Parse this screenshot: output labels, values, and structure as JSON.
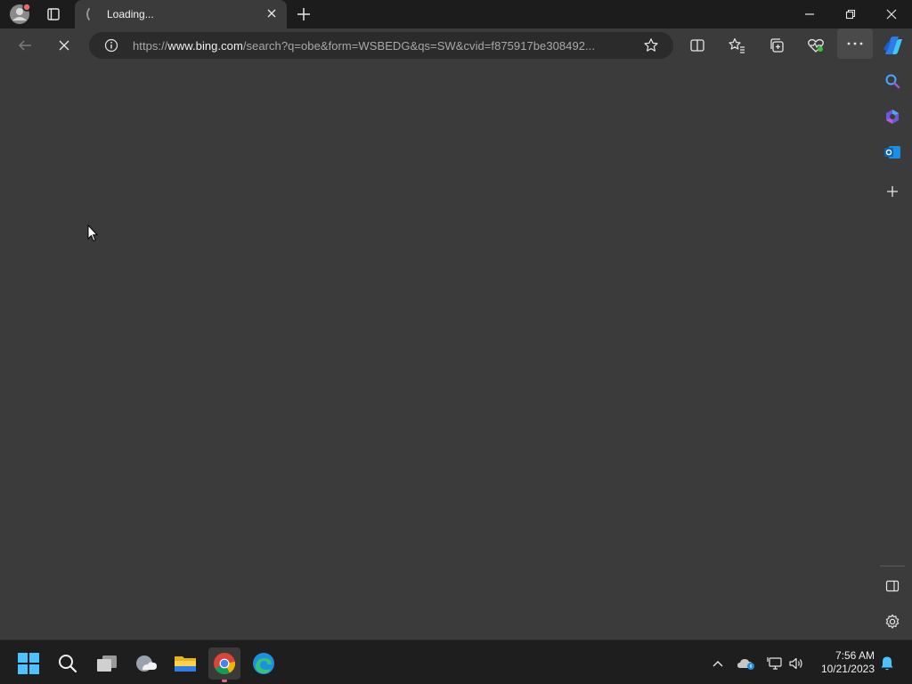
{
  "browser": {
    "tab": {
      "title": "Loading..."
    },
    "address": {
      "prefix": "https://",
      "host": "www.bing.com",
      "path": "/search?q=obe&form=WSBEDG&qs=SW&cvid=f875917be308492..."
    },
    "new_tab_icon": "plus-icon",
    "window_controls": [
      "minimize-icon",
      "restore-icon",
      "close-icon"
    ]
  },
  "toolbar_icons": [
    "split-screen-icon",
    "favorites-icon",
    "collections-icon",
    "browser-essentials-icon",
    "more-icon",
    "copilot-icon"
  ],
  "sidebar_icons": [
    "search-icon",
    "copilot-icon",
    "outlook-icon",
    "add-icon",
    "hide-sidebar-icon",
    "settings-icon"
  ],
  "taskbar": {
    "apps": [
      "start-icon",
      "search-icon",
      "task-view-icon",
      "weather-icon",
      "file-explorer-icon",
      "chrome-icon",
      "edge-icon"
    ],
    "clock": {
      "time": "7:56 AM",
      "date": "10/21/2023"
    }
  },
  "colors": {
    "accent_blue": "#0078d4",
    "chrome_red": "#db4437",
    "titlebar": "#1c1c1c",
    "page_bg": "#3b3b3b"
  }
}
